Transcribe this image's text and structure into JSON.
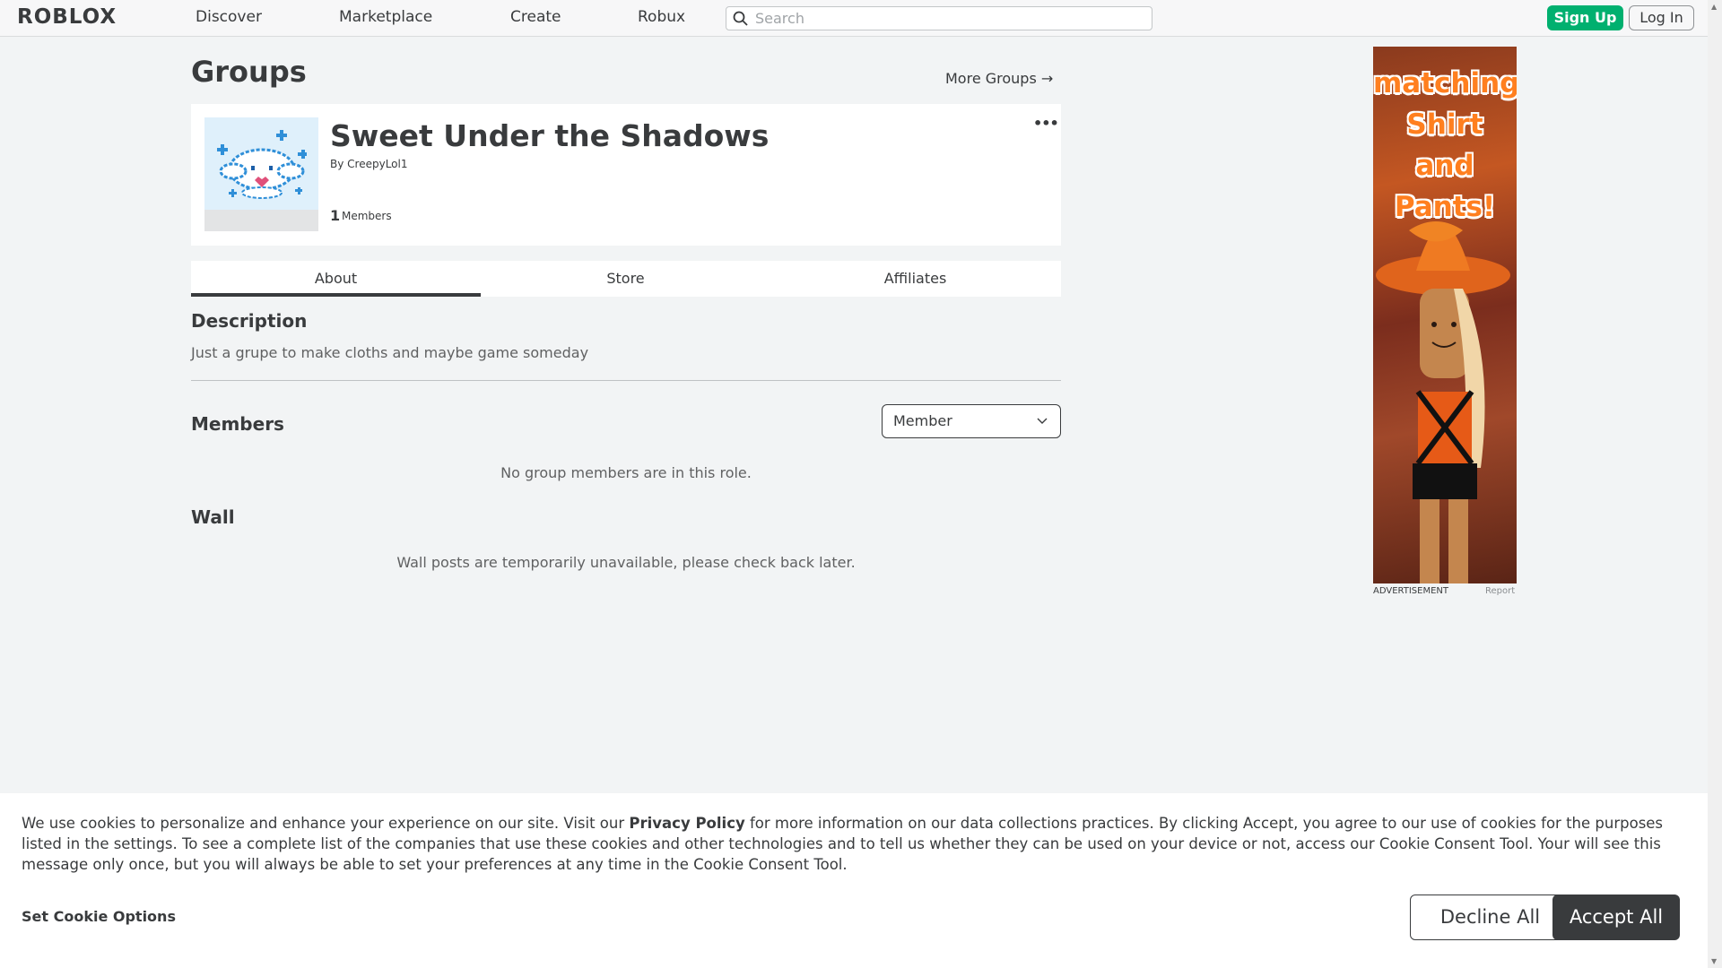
{
  "header": {
    "logo": "ROBLOX",
    "nav": [
      "Discover",
      "Marketplace",
      "Create",
      "Robux"
    ],
    "search_placeholder": "Search",
    "signup_label": "Sign Up",
    "login_label": "Log In"
  },
  "page": {
    "title": "Groups",
    "more_groups": "More Groups →"
  },
  "group": {
    "name": "Sweet Under the Shadows",
    "by_prefix": "By",
    "owner": "CreepyLol1",
    "member_count": "1",
    "members_label": "Members",
    "more_icon": "ellipsis-icon"
  },
  "tabs": [
    "About",
    "Store",
    "Affiliates"
  ],
  "about": {
    "description_title": "Description",
    "description": "Just a grupe to make cloths and maybe game someday",
    "members_title": "Members",
    "role_selected": "Member",
    "members_empty": "No group members are in this role.",
    "wall_title": "Wall",
    "wall_message": "Wall posts are temporarily unavailable, please check back later."
  },
  "ad": {
    "text_line1": "matching",
    "text_line2": "Shirt and",
    "text_line3": "Pants!",
    "label": "ADVERTISEMENT",
    "report": "Report"
  },
  "cookie": {
    "text_before": "We use cookies to personalize and enhance your experience on our site. Visit our ",
    "privacy_link": "Privacy Policy",
    "text_after": " for more information on our data collections practices. By clicking Accept, you agree to our use of cookies for the purposes listed in the settings. To see a complete list of the companies that use these cookies and other technologies and to tell us whether they can be used on your device or not, access our Cookie Consent Tool. Your will see this message only once, but you will always be able to set your preferences at any time in the Cookie Consent Tool.",
    "options_label": "Set Cookie Options",
    "decline_label": "Decline All",
    "accept_label": "Accept All"
  },
  "colors": {
    "signup_green": "#00b06f",
    "accept_dark": "#393b3d",
    "background": "#f2f4f5"
  }
}
